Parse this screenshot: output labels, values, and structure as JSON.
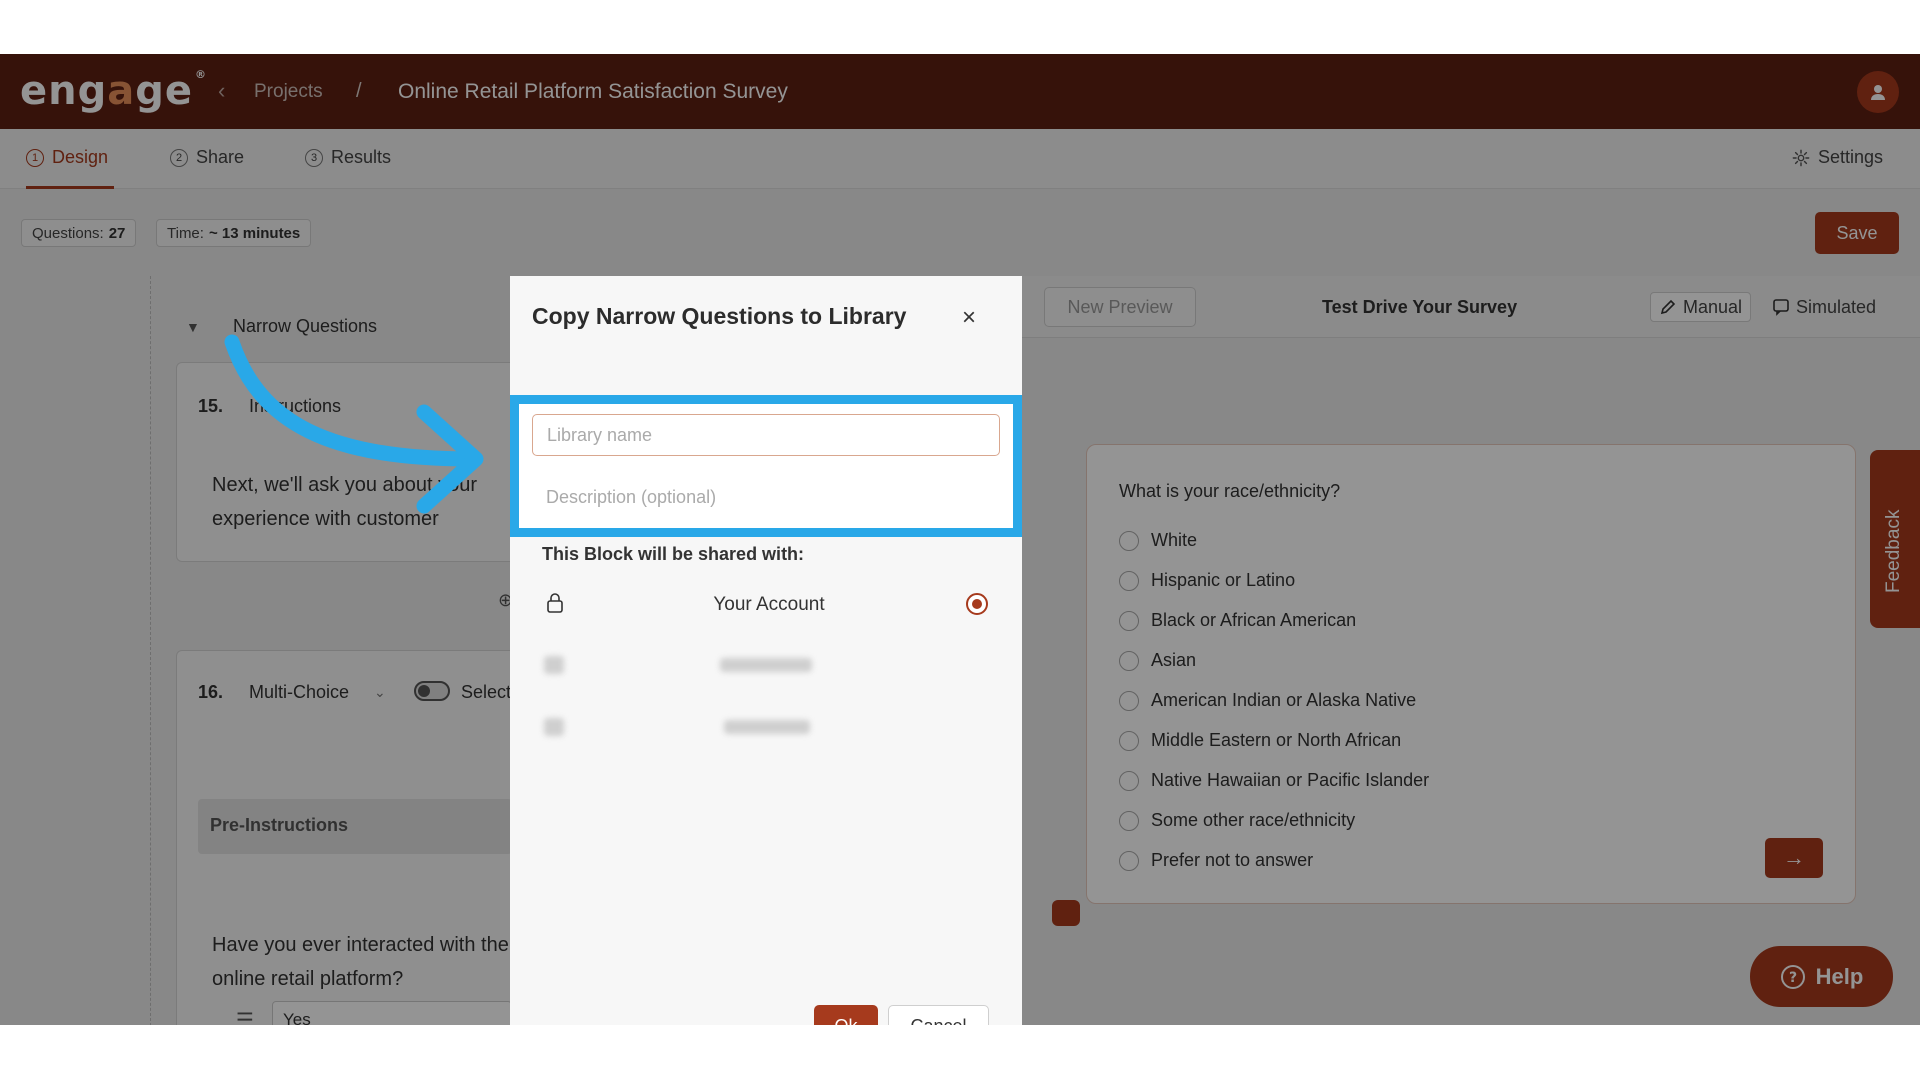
{
  "app": {
    "logo_text": "engage",
    "breadcrumb_projects": "Projects",
    "breadcrumb_separator": "/",
    "survey_title": "Online Retail Platform Satisfaction Survey"
  },
  "tabs": [
    {
      "num": "1",
      "label": "Design",
      "active": true
    },
    {
      "num": "2",
      "label": "Share",
      "active": false
    },
    {
      "num": "3",
      "label": "Results",
      "active": false
    }
  ],
  "settings_label": "Settings",
  "stats": {
    "questions_label": "Questions:",
    "questions_value": "27",
    "time_label": "Time:",
    "time_value": "~ 13 minutes"
  },
  "save_label": "Save",
  "editor": {
    "group_title": "Narrow Questions",
    "q15": {
      "num": "15.",
      "type": "Instructions",
      "body": "Next, we'll ask you about your experience with customer service."
    },
    "q16": {
      "num": "16.",
      "type": "Multi-Choice",
      "toggle_label": "Select"
    },
    "pre_instructions_label": "Pre-Instructions",
    "q16_body": "Have you ever interacted with the online retail platform?",
    "option_1": "Yes"
  },
  "preview": {
    "new_preview_label": "New Preview",
    "title": "Test Drive Your Survey",
    "manual_label": "Manual",
    "simulated_label": "Simulated",
    "question": "What is your race/ethnicity?",
    "choices": [
      "White",
      "Hispanic or Latino",
      "Black or African American",
      "Asian",
      "American Indian or Alaska Native",
      "Middle Eastern or North African",
      "Native Hawaiian or Pacific Islander",
      "Some other race/ethnicity",
      "Prefer not to answer"
    ],
    "next_symbol": "→"
  },
  "feedback_label": "Feedback",
  "help_label": "Help",
  "modal": {
    "title": "Copy Narrow Questions to Library",
    "close_symbol": "×",
    "library_name_placeholder": "Library name",
    "description_placeholder": "Description (optional)",
    "shared_with_label": "This Block will be shared with:",
    "share_option_1": "Your Account",
    "ok_label": "Ok",
    "cancel_label": "Cancel"
  },
  "colors": {
    "brand": "#a63a1d",
    "topbar": "#5e1f12",
    "highlight": "#29a8e8"
  }
}
